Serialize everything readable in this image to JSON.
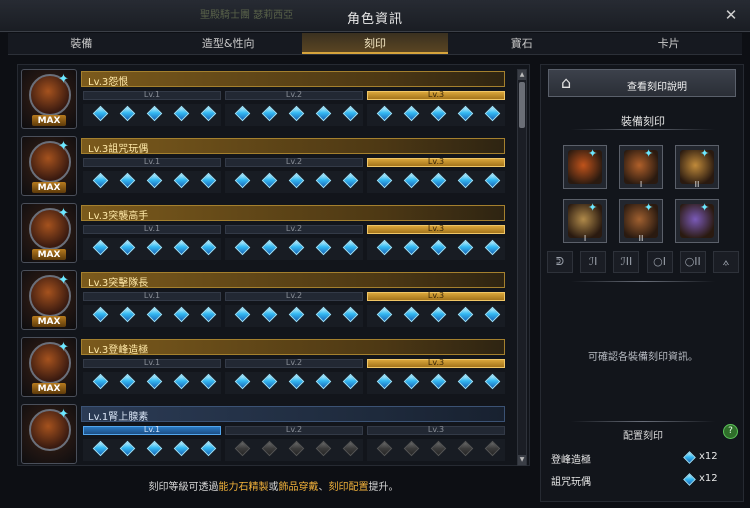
{
  "window": {
    "title": "角色資訊",
    "ghost_text": "聖殿騎士團   瑟莉西亞"
  },
  "tabs": [
    {
      "label": "裝備",
      "active": false
    },
    {
      "label": "造型&性向",
      "active": false
    },
    {
      "label": "刻印",
      "active": true
    },
    {
      "label": "寶石",
      "active": false
    },
    {
      "label": "卡片",
      "active": false
    }
  ],
  "engravings": [
    {
      "name": "Lv.3怨恨",
      "max_label": "MAX",
      "level": 3,
      "theme": "gold",
      "icon": "grudge-icon",
      "levels": [
        {
          "label": "Lv.1",
          "active": 5
        },
        {
          "label": "Lv.2",
          "active": 5
        },
        {
          "label": "Lv.3",
          "active": 5
        }
      ]
    },
    {
      "name": "Lv.3詛咒玩偶",
      "max_label": "MAX",
      "level": 3,
      "theme": "gold",
      "icon": "cursed-doll-icon",
      "levels": [
        {
          "label": "Lv.1",
          "active": 5
        },
        {
          "label": "Lv.2",
          "active": 5
        },
        {
          "label": "Lv.3",
          "active": 5
        }
      ]
    },
    {
      "name": "Lv.3突襲高手",
      "max_label": "MAX",
      "level": 3,
      "theme": "gold",
      "icon": "master-of-ambush-icon",
      "levels": [
        {
          "label": "Lv.1",
          "active": 5
        },
        {
          "label": "Lv.2",
          "active": 5
        },
        {
          "label": "Lv.3",
          "active": 5
        }
      ]
    },
    {
      "name": "Lv.3突擊隊長",
      "max_label": "MAX",
      "level": 3,
      "theme": "gold",
      "icon": "raid-captain-icon",
      "levels": [
        {
          "label": "Lv.1",
          "active": 5
        },
        {
          "label": "Lv.2",
          "active": 5
        },
        {
          "label": "Lv.3",
          "active": 5
        }
      ]
    },
    {
      "name": "Lv.3登峰造極",
      "max_label": "MAX",
      "level": 3,
      "theme": "gold",
      "icon": "peak-icon",
      "levels": [
        {
          "label": "Lv.1",
          "active": 5
        },
        {
          "label": "Lv.2",
          "active": 5
        },
        {
          "label": "Lv.3",
          "active": 5
        }
      ]
    },
    {
      "name": "Lv.1腎上腺素",
      "max_label": "",
      "level": 1,
      "theme": "blue",
      "icon": "adrenaline-icon",
      "levels": [
        {
          "label": "Lv.1",
          "active": 5
        },
        {
          "label": "Lv.2",
          "active": 0
        },
        {
          "label": "Lv.3",
          "active": 0
        }
      ]
    }
  ],
  "footer": {
    "p1": "刻印等級可透過",
    "h1": "能力石精製",
    "p2": "或",
    "h2": "飾品穿戴",
    "p3": "、",
    "h3": "刻印配置",
    "p4": "提升。"
  },
  "right": {
    "help_button": "查看刻印說明",
    "equip_title": "裝備刻印",
    "slots": [
      {
        "name": "necklace-slot",
        "numeral": "",
        "color": "#c0531b"
      },
      {
        "name": "earring-slot-1",
        "numeral": "I",
        "color": "#b0602a"
      },
      {
        "name": "earring-slot-2",
        "numeral": "II",
        "color": "#c08a3a"
      },
      {
        "name": "ring-slot-1",
        "numeral": "I",
        "color": "#b08a4a"
      },
      {
        "name": "ring-slot-2",
        "numeral": "II",
        "color": "#a06030"
      },
      {
        "name": "ability-stone-slot",
        "numeral": "",
        "color": "#7a5ab8"
      }
    ],
    "slot_icons": [
      "necklace-icon",
      "earring-icon",
      "earring-icon",
      "ring-icon",
      "ring-icon",
      "stone-icon"
    ],
    "slot_icon_glyphs": [
      "ᕲ",
      "ℐI",
      "ℐII",
      "○I",
      "○II",
      "⟑"
    ],
    "info_text": "可確認各裝備刻印資訊。",
    "config_title": "配置刻印",
    "help_q": "?",
    "config": [
      {
        "name": "登峰造極",
        "count": "x12"
      },
      {
        "name": "詛咒玩偶",
        "count": "x12"
      }
    ]
  },
  "colors": {
    "gold_accent": "#d6a43c",
    "gem_blue": "#34b9f2",
    "highlight_orange": "#f2b23a"
  }
}
